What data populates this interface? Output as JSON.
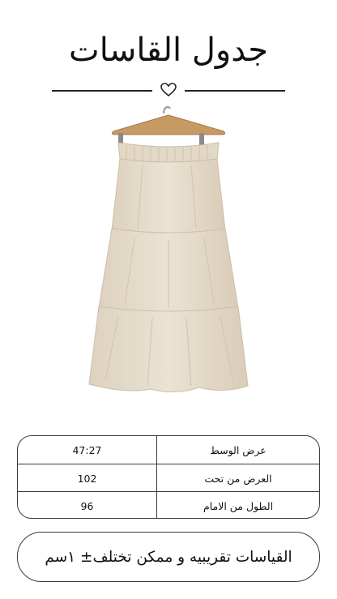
{
  "title": "جدول القاسات",
  "icons": {
    "divider": "heart-icon",
    "product": "skirt-on-hanger-image"
  },
  "colors": {
    "skirt": "#e6dccb",
    "hanger": "#c89a63",
    "border": "#3a3a3a"
  },
  "table": {
    "rows": [
      {
        "label": "عرض الوسط",
        "value": "47:27"
      },
      {
        "label": "العرض من تحت",
        "value": "102"
      },
      {
        "label": "الطول من الامام",
        "value": "96"
      }
    ]
  },
  "note": "القياسات تقريبيه و ممكن تختلف± ١سم"
}
